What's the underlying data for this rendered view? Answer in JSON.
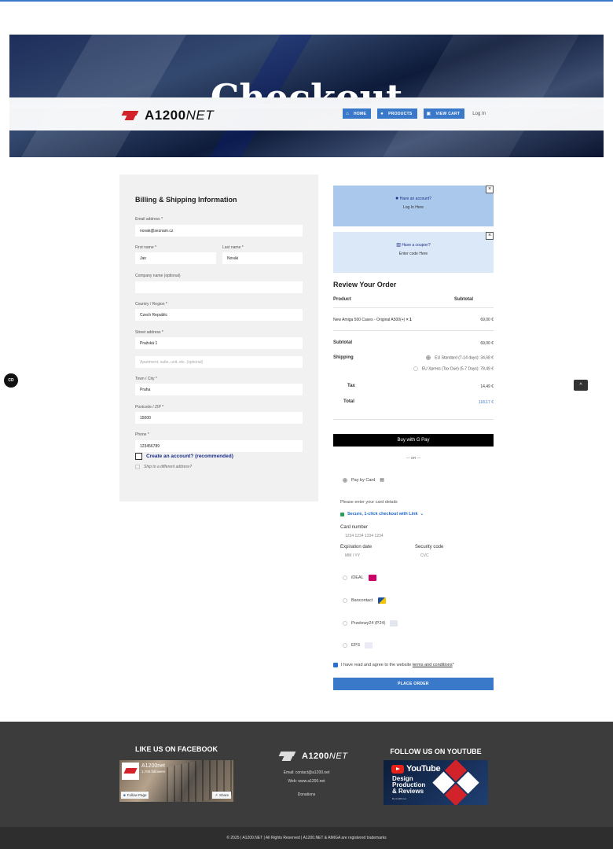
{
  "hero": {
    "title": "Checkout"
  },
  "header": {
    "logo_text": "A1200",
    "logo_text_suffix": "NET",
    "nav": [
      {
        "label": "HOME",
        "icon": "home-icon"
      },
      {
        "label": "PRODUCTS",
        "icon": "products-icon"
      },
      {
        "label": "VIEW CART",
        "icon": "cart-icon"
      }
    ],
    "login": "Log In"
  },
  "billing": {
    "title": "Billing & Shipping Information",
    "email_label": "Email address *",
    "email_value": "novak@seznam.cz",
    "first_name_label": "First name *",
    "first_name_value": "Jan",
    "last_name_label": "Last name *",
    "last_name_value": "Novák",
    "company_label": "Company name (optional)",
    "company_value": "",
    "country_label": "Country / Region *",
    "country_value": "Czech Republic",
    "street_label": "Street address *",
    "street_value": "Pražská 1",
    "street2_placeholder": "Apartment, suite, unit, etc. (optional)",
    "city_label": "Town / City *",
    "city_value": "Praha",
    "postcode_label": "Postcode / ZIP *",
    "postcode_value": "15000",
    "phone_label": "Phone *",
    "phone_value": "123456789",
    "create_account": "Create an account? (recommended)",
    "ship_different": "Ship to a different address?"
  },
  "badges": {
    "cd": "CD",
    "to_top": "^"
  },
  "notices": {
    "account_title": "Have an account?",
    "account_link": "Log In Here",
    "coupon_title": "Have a coupon?",
    "coupon_link": "Enter code Here",
    "close": "×"
  },
  "order": {
    "title": "Review Your Order",
    "col_product": "Product",
    "col_subtotal": "Subtotal",
    "item_name": "New Amiga 500 Cases - Original A500(+)",
    "item_qty": "× 1",
    "item_total": "69,00 €",
    "subtotal_label": "Subtotal",
    "subtotal_value": "69,00 €",
    "shipping_label": "Shipping",
    "shipping_options": [
      "EU Standard (7-14 days): 34,68 €",
      "EU Xpress (Tax Due) (5-7 Days): 78,49 €"
    ],
    "tax_label": "Tax",
    "tax_value": "14,49 €",
    "total_label": "Total",
    "total_value": "118,17 €"
  },
  "payment": {
    "gpay": "Buy with G Pay",
    "or": "— OR —",
    "pay_by_card": "Pay by Card",
    "enter_details": "Please enter your card details",
    "link_text": "Secure, 1-click checkout with Link",
    "card_number_label": "Card number",
    "card_number_placeholder": "1234 1234 1234 1234",
    "expiry_label": "Expiration date",
    "expiry_placeholder": "MM / YY",
    "cvc_label": "Security code",
    "cvc_placeholder": "CVC",
    "methods": [
      "iDEAL",
      "Bancontact",
      "Przelewy24 (P24)",
      "EPS"
    ],
    "agree_prefix": "I have read and agree to the website ",
    "agree_link": "terms and conditions",
    "agree_suffix": " *",
    "place_order": "PLACE ORDER"
  },
  "footer": {
    "facebook_title": "LIKE US ON FACEBOOK",
    "fb_name": "A1200net",
    "fb_followers": "1,706 followers",
    "fb_follow": "Follow Page",
    "fb_share": "Share",
    "email": "Email: contact@a1200.net",
    "web": "Web: www.a1200.net",
    "donations": "Donations",
    "youtube_title": "FOLLOW US ON YOUTUBE",
    "yt_word": "YouTube",
    "yt_lines": [
      "Design",
      "Production",
      "& Reviews"
    ],
    "yt_by": "By A1200.net",
    "copyright": "© 2025  |  A1200.NET  |  All Rights Reserved  |  A1200.NET & AMIGA are registered trademarks"
  }
}
